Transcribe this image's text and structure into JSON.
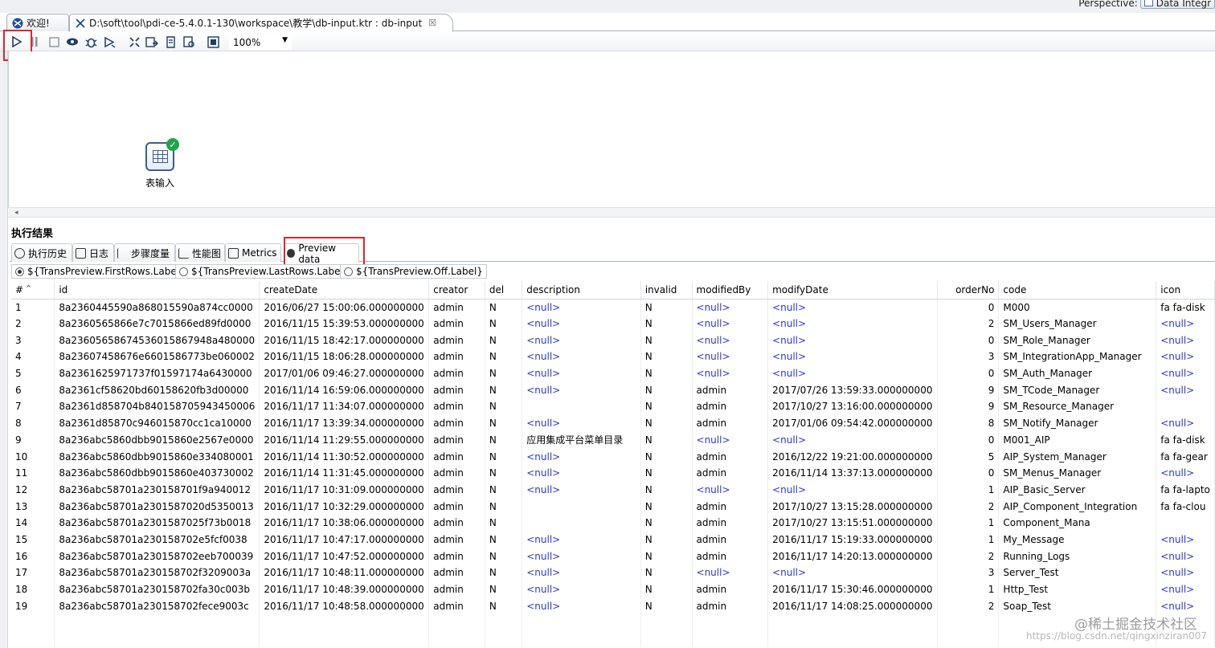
{
  "perspective": {
    "label": "Perspective:",
    "value": "Data Integr"
  },
  "tabs": [
    {
      "label": "欢迎!",
      "icon": "welcome-icon"
    },
    {
      "label": "D:\\soft\\tool\\pdi-ce-5.4.0.1-130\\workspace\\教学\\db-input.ktr : db-input",
      "icon": "transformation-icon",
      "close": "☒"
    }
  ],
  "toolbar": {
    "zoom": "100%"
  },
  "canvas": {
    "step_label": "表输入"
  },
  "results": {
    "title": "执行结果"
  },
  "result_tabs": [
    "执行历史",
    "日志",
    "步骤度量",
    "性能图",
    "Metrics",
    "Preview data"
  ],
  "preview_options": [
    "${TransPreview.FirstRows.Label}",
    "${TransPreview.LastRows.Label}",
    "${TransPreview.Off.Label}"
  ],
  "table": {
    "columns": [
      "#",
      "id",
      "createDate",
      "creator",
      "del",
      "description",
      "invalid",
      "modifiedBy",
      "modifyDate",
      "orderNo",
      "code",
      "icon"
    ],
    "rows": [
      [
        "1",
        "8a2360445590a868015590a874cc0000",
        "2016/06/27 15:00:06.000000000",
        "admin",
        "N",
        "<null>",
        "N",
        "<null>",
        "<null>",
        "0",
        "M000",
        "fa fa-disk"
      ],
      [
        "2",
        "8a2360565866e7c7015866ed89fd0000",
        "2016/11/15 15:39:53.000000000",
        "admin",
        "N",
        "<null>",
        "N",
        "<null>",
        "<null>",
        "2",
        "SM_Users_Manager",
        "<null>"
      ],
      [
        "3",
        "8a23605658674536015867948a480000",
        "2016/11/15 18:42:17.000000000",
        "admin",
        "N",
        "<null>",
        "N",
        "<null>",
        "<null>",
        "0",
        "SM_Role_Manager",
        "<null>"
      ],
      [
        "4",
        "8a23607458676e6601586773be060002",
        "2016/11/15 18:06:28.000000000",
        "admin",
        "N",
        "<null>",
        "N",
        "<null>",
        "<null>",
        "3",
        "SM_IntegrationApp_Manager",
        "<null>"
      ],
      [
        "5",
        "8a2361625971737f01597174a6430000",
        "2017/01/06 09:46:27.000000000",
        "admin",
        "N",
        "<null>",
        "N",
        "<null>",
        "<null>",
        "0",
        "SM_Auth_Manager",
        "<null>"
      ],
      [
        "6",
        "8a2361cf58620bd60158620fb3d00000",
        "2016/11/14 16:59:06.000000000",
        "admin",
        "N",
        "<null>",
        "N",
        "admin",
        "2017/07/26 13:59:33.000000000",
        "9",
        "SM_TCode_Manager",
        "<null>"
      ],
      [
        "7",
        "8a2361d858704b840158705943450006",
        "2016/11/17 11:34:07.000000000",
        "admin",
        "N",
        "",
        "N",
        "admin",
        "2017/10/27 13:16:00.000000000",
        "9",
        "SM_Resource_Manager",
        ""
      ],
      [
        "8",
        "8a2361d85870c946015870cc1ca10000",
        "2016/11/17 13:39:34.000000000",
        "admin",
        "N",
        "<null>",
        "N",
        "admin",
        "2017/01/06 09:54:42.000000000",
        "8",
        "SM_Notify_Manager",
        "<null>"
      ],
      [
        "9",
        "8a236abc5860dbb9015860e2567e0000",
        "2016/11/14 11:29:55.000000000",
        "admin",
        "N",
        "应用集成平台菜单目录",
        "N",
        "<null>",
        "<null>",
        "0",
        "M001_AIP",
        "fa fa-disk"
      ],
      [
        "10",
        "8a236abc5860dbb9015860e334080001",
        "2016/11/14 11:30:52.000000000",
        "admin",
        "N",
        "<null>",
        "N",
        "admin",
        "2016/12/22 19:21:00.000000000",
        "5",
        "AIP_System_Manager",
        "fa fa-gear"
      ],
      [
        "11",
        "8a236abc5860dbb9015860e403730002",
        "2016/11/14 11:31:45.000000000",
        "admin",
        "N",
        "<null>",
        "N",
        "admin",
        "2016/11/14 13:37:13.000000000",
        "0",
        "SM_Menus_Manager",
        "<null>"
      ],
      [
        "12",
        "8a236abc58701a230158701f9a940012",
        "2016/11/17 10:31:09.000000000",
        "admin",
        "N",
        "<null>",
        "N",
        "<null>",
        "<null>",
        "1",
        "AIP_Basic_Server",
        "fa fa-lapto"
      ],
      [
        "13",
        "8a236abc58701a2301587020d5350013",
        "2016/11/17 10:32:29.000000000",
        "admin",
        "N",
        "",
        "N",
        "admin",
        "2017/10/27 13:15:28.000000000",
        "2",
        "AIP_Component_Integration",
        "fa fa-clou"
      ],
      [
        "14",
        "8a236abc58701a2301587025f73b0018",
        "2016/11/17 10:38:06.000000000",
        "admin",
        "N",
        "",
        "N",
        "admin",
        "2017/10/27 13:15:51.000000000",
        "1",
        "Component_Mana",
        ""
      ],
      [
        "15",
        "8a236abc58701a230158702e5fcf0038",
        "2016/11/17 10:47:17.000000000",
        "admin",
        "N",
        "<null>",
        "N",
        "admin",
        "2016/11/17 15:19:33.000000000",
        "1",
        "My_Message",
        "<null>"
      ],
      [
        "16",
        "8a236abc58701a230158702eeb700039",
        "2016/11/17 10:47:52.000000000",
        "admin",
        "N",
        "<null>",
        "N",
        "admin",
        "2016/11/17 14:20:13.000000000",
        "2",
        "Running_Logs",
        "<null>"
      ],
      [
        "17",
        "8a236abc58701a230158702f3209003a",
        "2016/11/17 10:48:11.000000000",
        "admin",
        "N",
        "<null>",
        "N",
        "<null>",
        "<null>",
        "3",
        "Server_Test",
        "<null>"
      ],
      [
        "18",
        "8a236abc58701a230158702fa30c003b",
        "2016/11/17 10:48:39.000000000",
        "admin",
        "N",
        "<null>",
        "N",
        "admin",
        "2016/11/17 15:30:46.000000000",
        "1",
        "Http_Test",
        "<null>"
      ],
      [
        "19",
        "8a236abc58701a230158702fece9003c",
        "2016/11/17 10:48:58.000000000",
        "admin",
        "N",
        "<null>",
        "N",
        "admin",
        "2016/11/17 14:08:25.000000000",
        "2",
        "Soap_Test",
        "<null>"
      ]
    ]
  },
  "watermark": "@稀土掘金技术社区",
  "watermark_url": "https://blog.csdn.net/qingxinziran007"
}
